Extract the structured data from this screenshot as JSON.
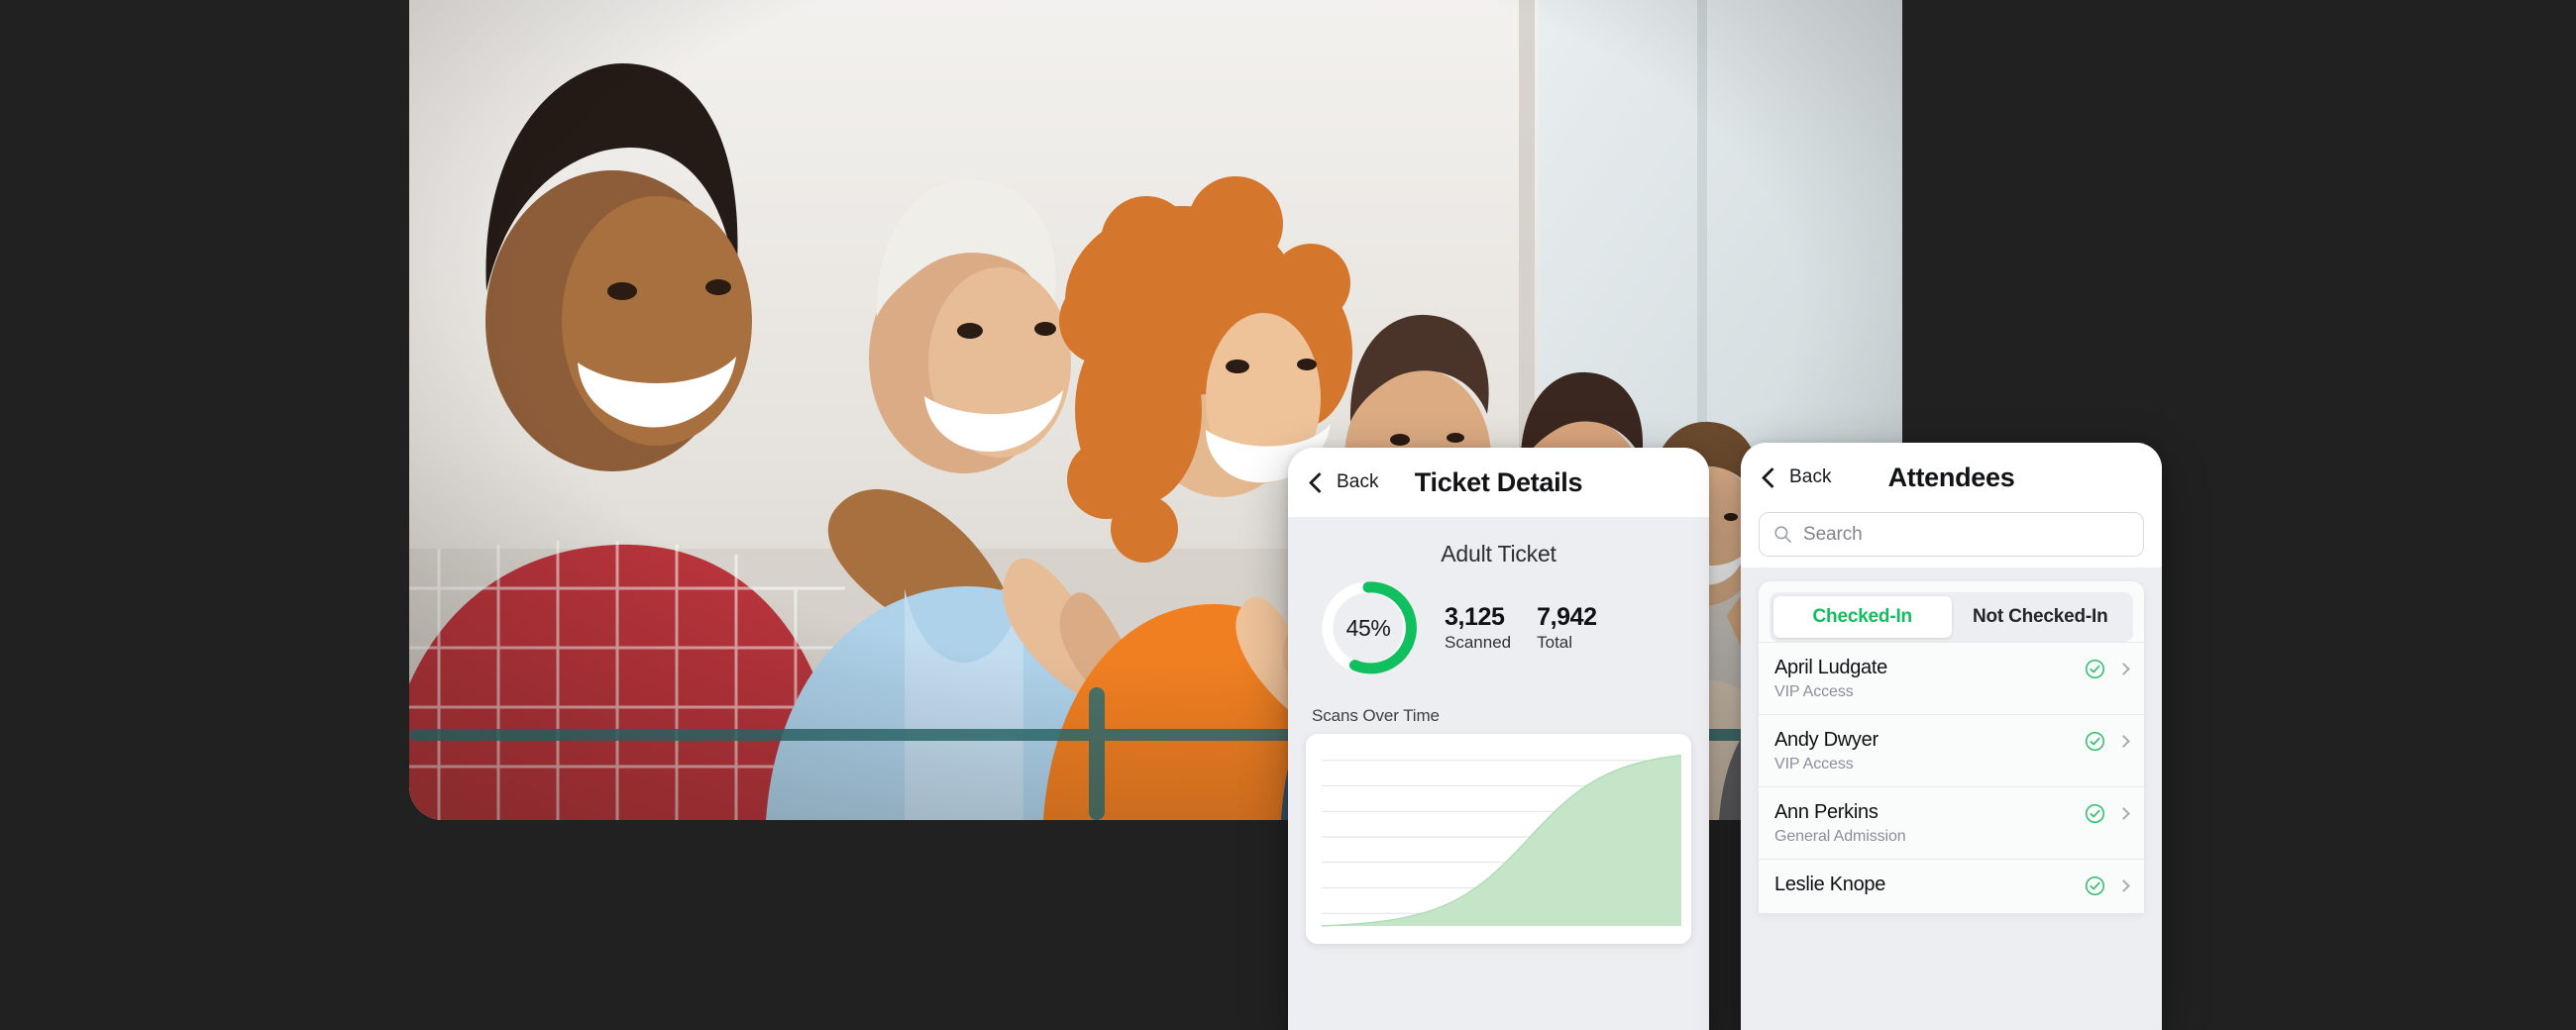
{
  "theme": {
    "background": "#212121",
    "panel_surface": "#edeef1",
    "card_surface": "#ffffff",
    "accent_green": "#10c05e",
    "accent_green_text": "#12bd5d",
    "chart_fill": "#c5e5c9",
    "muted_text": "#8b9097"
  },
  "hero": {
    "name": "audience-applauding-photo",
    "alt": "Audience of people seated in a row smiling and applauding"
  },
  "ticket_panel": {
    "back_label": "Back",
    "title": "Ticket Details",
    "ticket_name": "Adult Ticket",
    "donut": {
      "percent_label": "45%",
      "percent_value": 45,
      "track_color": "#ffffff",
      "arc_color": "#10c05e"
    },
    "stats": [
      {
        "value": "3,125",
        "label": "Scanned"
      },
      {
        "value": "7,942",
        "label": "Total"
      }
    ],
    "chart_heading": "Scans Over Time"
  },
  "attendees_panel": {
    "back_label": "Back",
    "title": "Attendees",
    "search": {
      "placeholder": "Search",
      "value": "",
      "icon": "search-icon"
    },
    "segments": [
      {
        "label": "Checked-In",
        "active": true
      },
      {
        "label": "Not Checked-In",
        "active": false
      }
    ],
    "rows": [
      {
        "name": "April Ludgate",
        "tier": "VIP Access",
        "checked_in": true
      },
      {
        "name": "Andy Dwyer",
        "tier": "VIP Access",
        "checked_in": true
      },
      {
        "name": "Ann Perkins",
        "tier": "General Admission",
        "checked_in": true
      },
      {
        "name": "Leslie Knope",
        "tier": "",
        "checked_in": true
      }
    ]
  },
  "chart_data": {
    "type": "area",
    "title": "Scans Over Time",
    "xlabel": "",
    "ylabel": "",
    "grid": true,
    "gridlines": 7,
    "legend": null,
    "x": [
      0,
      5,
      10,
      15,
      20,
      25,
      30,
      35,
      40,
      45,
      50,
      55,
      60,
      65,
      70,
      75,
      80,
      85,
      90,
      95,
      100
    ],
    "values": [
      0,
      0.5,
      1.2,
      2.2,
      3.6,
      5.6,
      8.4,
      12.3,
      17.6,
      24.6,
      33.4,
      43.6,
      54.4,
      64.6,
      73.4,
      80.4,
      85.7,
      89.6,
      92.4,
      94.4,
      95.8
    ],
    "ylim": [
      0,
      100
    ],
    "xlim": [
      0,
      100
    ],
    "fill_color": "#c5e5c9",
    "line_color": "#aedbb4"
  }
}
